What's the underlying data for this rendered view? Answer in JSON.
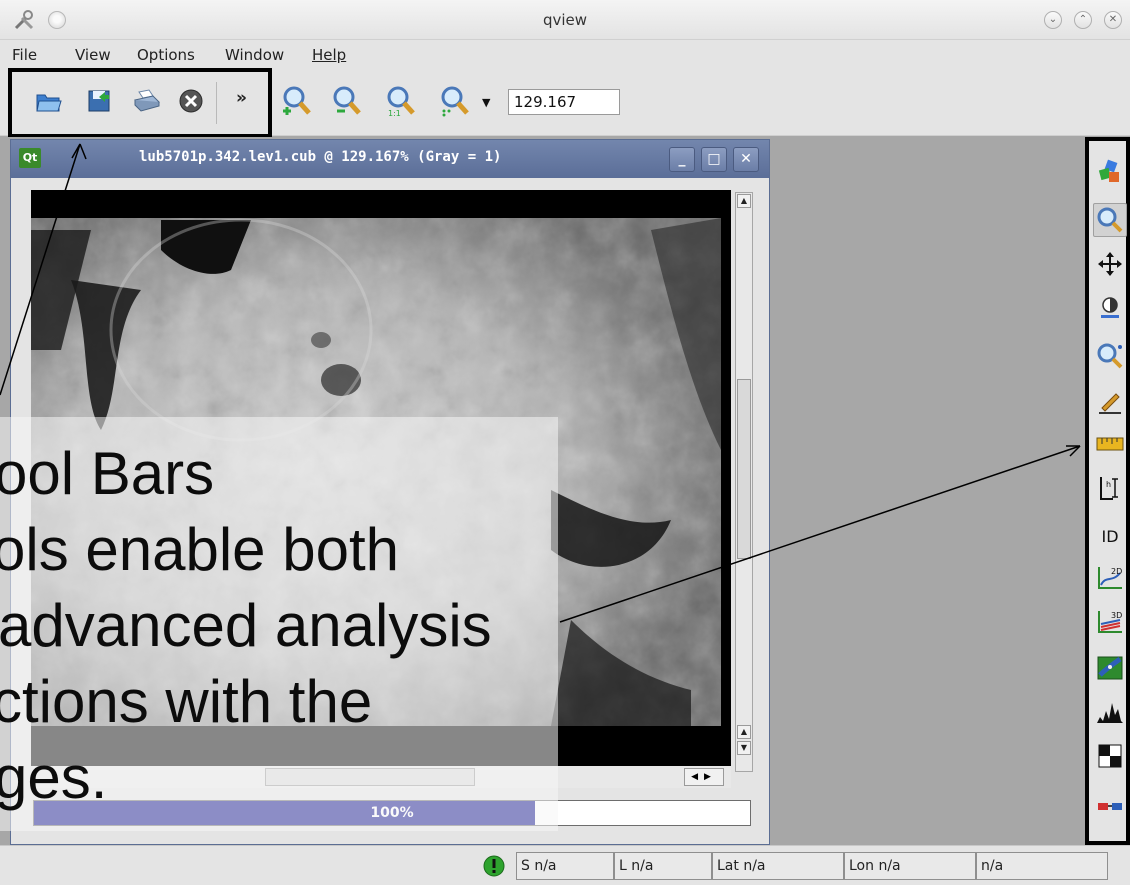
{
  "window": {
    "title": "qview"
  },
  "menu": [
    "File",
    "View",
    "Options",
    "Window",
    "Help"
  ],
  "toolbar": {
    "buttons": [
      "open-icon",
      "export-icon",
      "print-icon",
      "close-cube-icon"
    ],
    "overflow_label": "»",
    "zoom_buttons": [
      "zoom-in-icon",
      "zoom-out-icon",
      "zoom-actual-icon",
      "zoom-fit-icon"
    ],
    "zoom_value": "129.167"
  },
  "subwindow": {
    "badge": "Qt",
    "title": "lub5701p.342.lev1.cub @ 129.167% (Gray = 1)",
    "controls": [
      "_",
      "□",
      "✕"
    ],
    "progress_label": "100%",
    "progress_value": 0.7
  },
  "overlay": {
    "lines": [
      "ool Bars",
      "ols   enable   both",
      " advanced analysis",
      "ctions    with    the",
      "ges."
    ]
  },
  "right_tools": [
    "blend-icon",
    "zoom-icon",
    "pan-icon",
    "stretch-icon",
    "find-icon",
    "edit-icon",
    "measure-icon",
    "histogram-label-icon",
    "ID",
    "plot-2d-icon",
    "plot-3d-icon",
    "scatter-icon",
    "histogram-icon",
    "stereo-icon",
    "glasses-icon"
  ],
  "status": {
    "sample": "S n/a",
    "line": "L n/a",
    "lat": "Lat n/a",
    "lon": "Lon n/a",
    "value": "n/a"
  },
  "colors": {
    "subwindow_title": "#5f729b",
    "progress": "#0c0f8c",
    "highlight": "#000000"
  }
}
